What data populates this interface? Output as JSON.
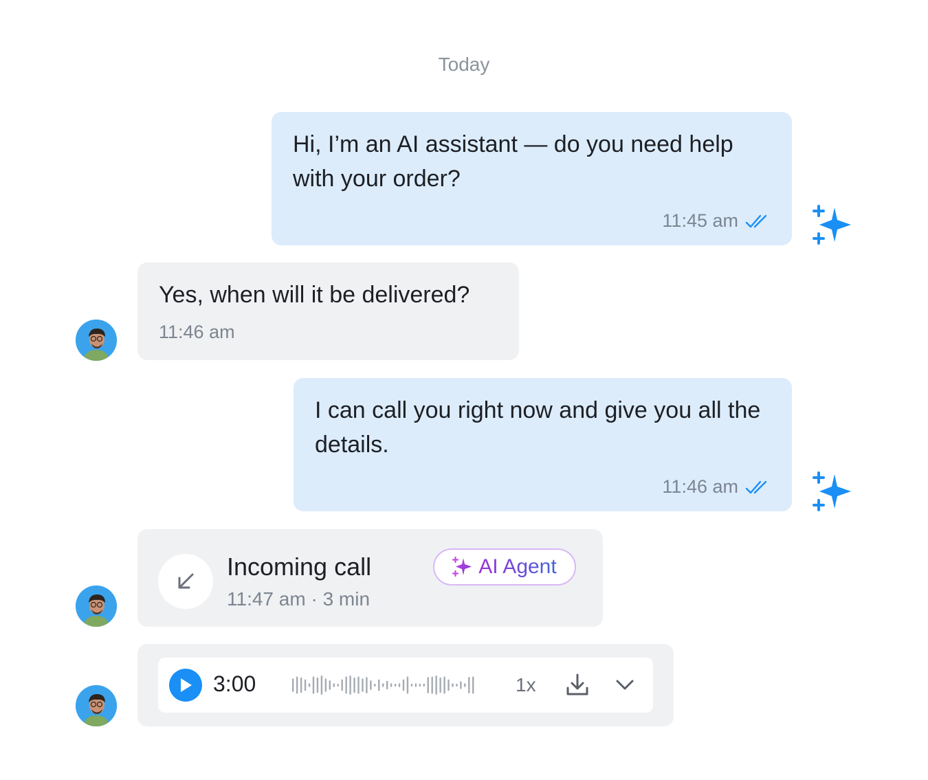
{
  "day_separator": "Today",
  "messages": [
    {
      "text": "Hi, I’m an AI assistant — do you need help with your order?",
      "time": "11:45 am",
      "status_icon": "double-check-icon",
      "sender_mark": "ai-sparkle-icon"
    },
    {
      "text": "Yes, when will it be delivered?",
      "time": "11:46 am",
      "sender_avatar": "avatar"
    },
    {
      "text": "I can call you right now and give you all the details.",
      "time": "11:46 am",
      "status_icon": "double-check-icon",
      "sender_mark": "ai-sparkle-icon"
    }
  ],
  "call": {
    "icon": "incoming-arrow-icon",
    "title": "Incoming call",
    "time": "11:47 am",
    "duration": "3 min",
    "badge": "AI Agent"
  },
  "recording": {
    "duration": "3:00",
    "speed": "1x",
    "icons": [
      "play-icon",
      "waveform",
      "download-icon",
      "chevron-down-icon"
    ]
  },
  "colors": {
    "outgoing_bubble": "#dcecfb",
    "incoming_bubble": "#f0f1f3",
    "accent_blue": "#1a8ff5",
    "badge_purple": "#9b2fd9",
    "meta_gray": "#7c8590"
  }
}
